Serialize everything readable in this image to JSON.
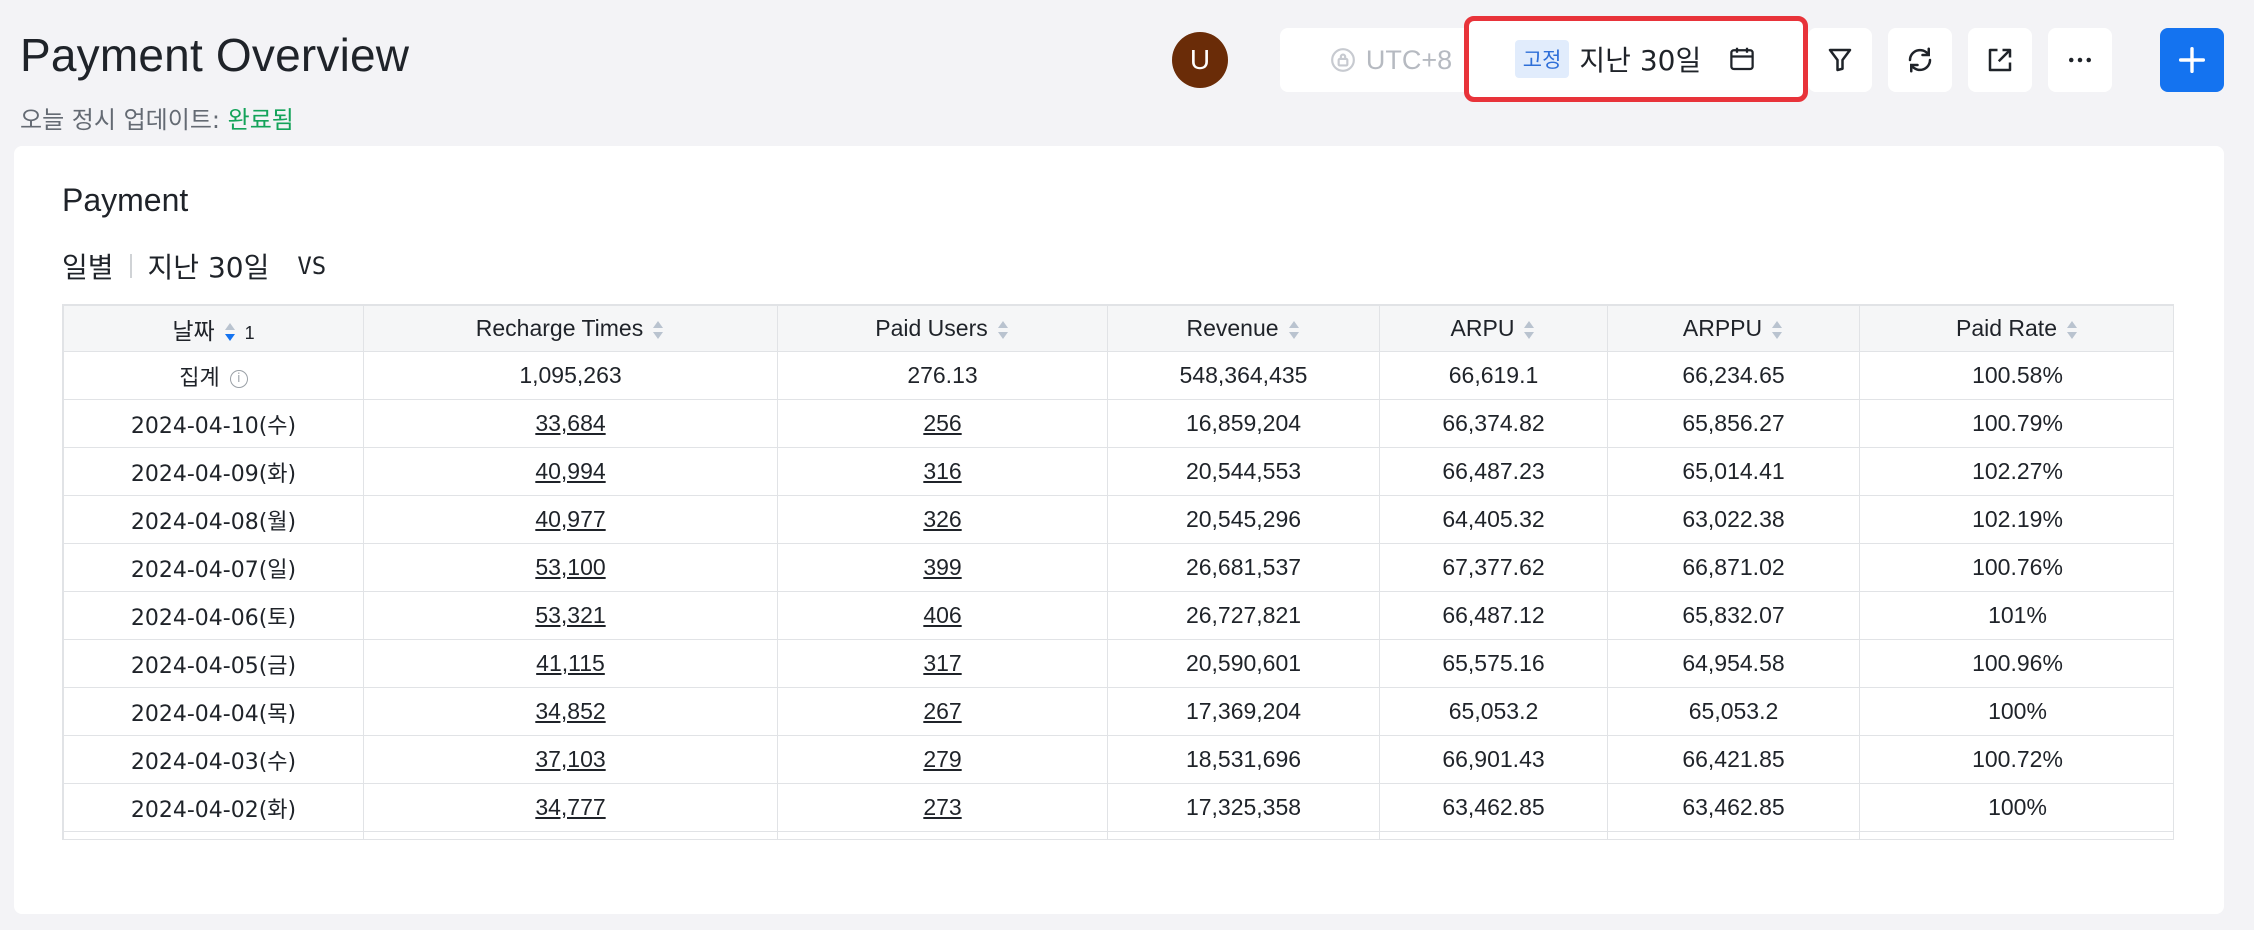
{
  "header": {
    "title": "Payment Overview",
    "status_prefix": "오늘 정시 업데이트: ",
    "status_value": "완료됨",
    "avatar_letter": "U",
    "timezone": "UTC+8",
    "date_tag": "고정",
    "date_range": "지난 30일",
    "colors": {
      "accent": "#1473f0",
      "highlight_border": "#e8333a",
      "status_ok": "#14a35a"
    }
  },
  "card": {
    "title": "Payment",
    "granularity": "일별",
    "range": "지난 30일",
    "compare": "VS"
  },
  "table": {
    "columns": [
      "날짜",
      "Recharge Times",
      "Paid Users",
      "Revenue",
      "ARPU",
      "ARPPU",
      "Paid Rate"
    ],
    "sort_index": "1",
    "summary": [
      "집계",
      "1,095,263",
      "276.13",
      "548,364,435",
      "66,619.1",
      "66,234.65",
      "100.58%"
    ],
    "rows": [
      [
        "2024-04-10(수)",
        "33,684",
        "256",
        "16,859,204",
        "66,374.82",
        "65,856.27",
        "100.79%"
      ],
      [
        "2024-04-09(화)",
        "40,994",
        "316",
        "20,544,553",
        "66,487.23",
        "65,014.41",
        "102.27%"
      ],
      [
        "2024-04-08(월)",
        "40,977",
        "326",
        "20,545,296",
        "64,405.32",
        "63,022.38",
        "102.19%"
      ],
      [
        "2024-04-07(일)",
        "53,100",
        "399",
        "26,681,537",
        "67,377.62",
        "66,871.02",
        "100.76%"
      ],
      [
        "2024-04-06(토)",
        "53,321",
        "406",
        "26,727,821",
        "66,487.12",
        "65,832.07",
        "101%"
      ],
      [
        "2024-04-05(금)",
        "41,115",
        "317",
        "20,590,601",
        "65,575.16",
        "64,954.58",
        "100.96%"
      ],
      [
        "2024-04-04(목)",
        "34,852",
        "267",
        "17,369,204",
        "65,053.2",
        "65,053.2",
        "100%"
      ],
      [
        "2024-04-03(수)",
        "37,103",
        "279",
        "18,531,696",
        "66,901.43",
        "66,421.85",
        "100.72%"
      ],
      [
        "2024-04-02(화)",
        "34,777",
        "273",
        "17,325,358",
        "63,462.85",
        "63,462.85",
        "100%"
      ]
    ]
  }
}
